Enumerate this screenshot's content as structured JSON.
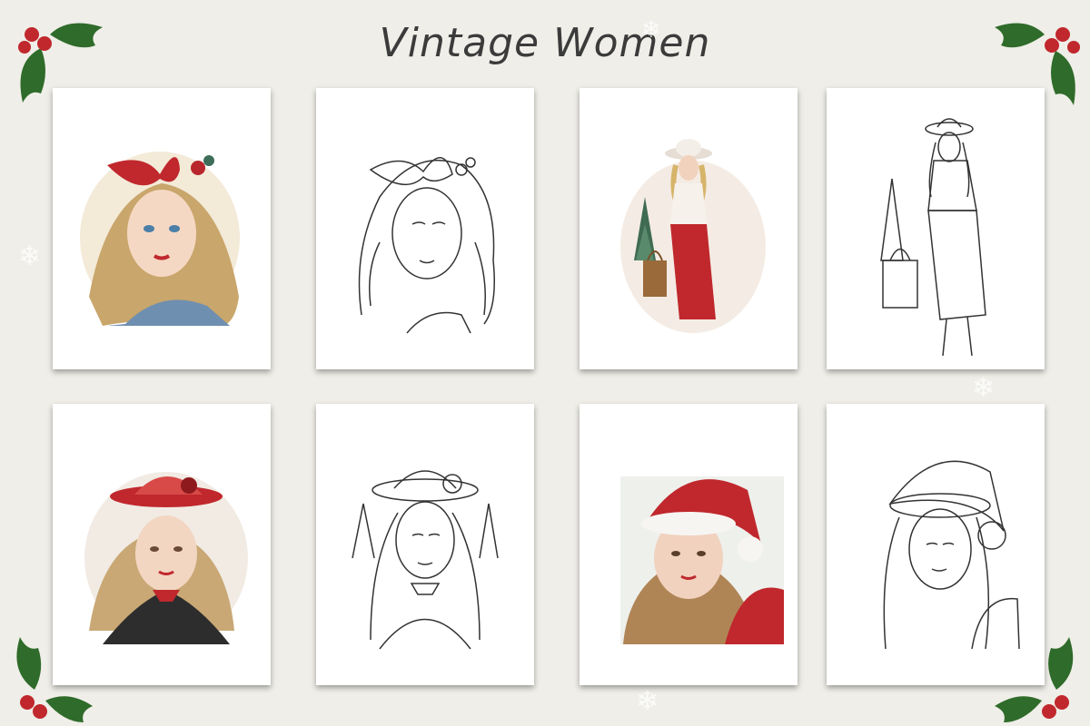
{
  "title": "Vintage Women",
  "colors": {
    "background": "#efeee8",
    "holly_green": "#2f6b2a",
    "berry_red": "#c0282d",
    "accent_red": "#b8252b"
  },
  "cards": [
    {
      "subject": "woman-red-bow-color",
      "style": "color"
    },
    {
      "subject": "woman-bow-lineart",
      "style": "lineart"
    },
    {
      "subject": "woman-hat-walking-color",
      "style": "color"
    },
    {
      "subject": "woman-hat-walking-lineart",
      "style": "lineart"
    },
    {
      "subject": "woman-red-hat-color",
      "style": "color"
    },
    {
      "subject": "woman-hat-lineart",
      "style": "lineart"
    },
    {
      "subject": "woman-santa-hat-color",
      "style": "color"
    },
    {
      "subject": "woman-santa-hat-lineart",
      "style": "lineart"
    }
  ]
}
